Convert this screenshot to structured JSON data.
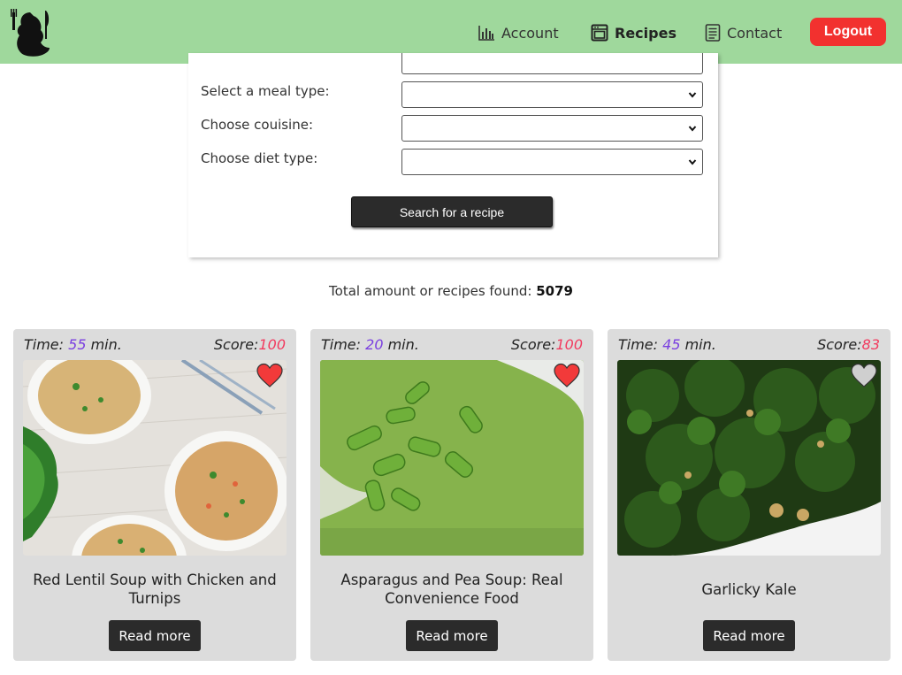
{
  "nav": {
    "account_label": "Account",
    "recipes_label": "Recipes",
    "contact_label": "Contact",
    "logout_label": "Logout"
  },
  "search": {
    "meal_type_label": "Select a meal type:",
    "cuisine_label": "Choose couisine:",
    "diet_label": "Choose diet type:",
    "meal_type_value": "",
    "cuisine_value": "",
    "diet_value": "",
    "button_label": "Search for a recipe"
  },
  "results": {
    "total_text": "Total amount or recipes found: ",
    "total_count": "5079"
  },
  "cards": [
    {
      "time_label": "Time:",
      "time_value": "55",
      "time_unit": "min.",
      "score_label": "Score:",
      "score_value": "100",
      "favorited": true,
      "title": "Red Lentil Soup with Chicken and Turnips",
      "button_label": "Read more"
    },
    {
      "time_label": "Time:",
      "time_value": "20",
      "time_unit": "min.",
      "score_label": "Score:",
      "score_value": "100",
      "favorited": true,
      "title": "Asparagus and Pea Soup: Real Convenience Food",
      "button_label": "Read more"
    },
    {
      "time_label": "Time:",
      "time_value": "45",
      "time_unit": "min.",
      "score_label": "Score:",
      "score_value": "83",
      "favorited": false,
      "title": "Garlicky Kale",
      "button_label": "Read more"
    }
  ],
  "icons": {
    "logo": "chef-silhouette-logo",
    "account": "bar-chart-icon",
    "recipes": "oven-icon",
    "contact": "contact-card-icon",
    "favorite": "heart-icon"
  },
  "colors": {
    "header_bg": "#9fd89c",
    "logout_bg": "#f2312f",
    "time_accent": "#7a3fe0",
    "score_accent": "#f23a5e",
    "heart_on": "#f23a3a",
    "heart_off": "#cfcfcf",
    "card_bg": "#dcdcdc"
  }
}
